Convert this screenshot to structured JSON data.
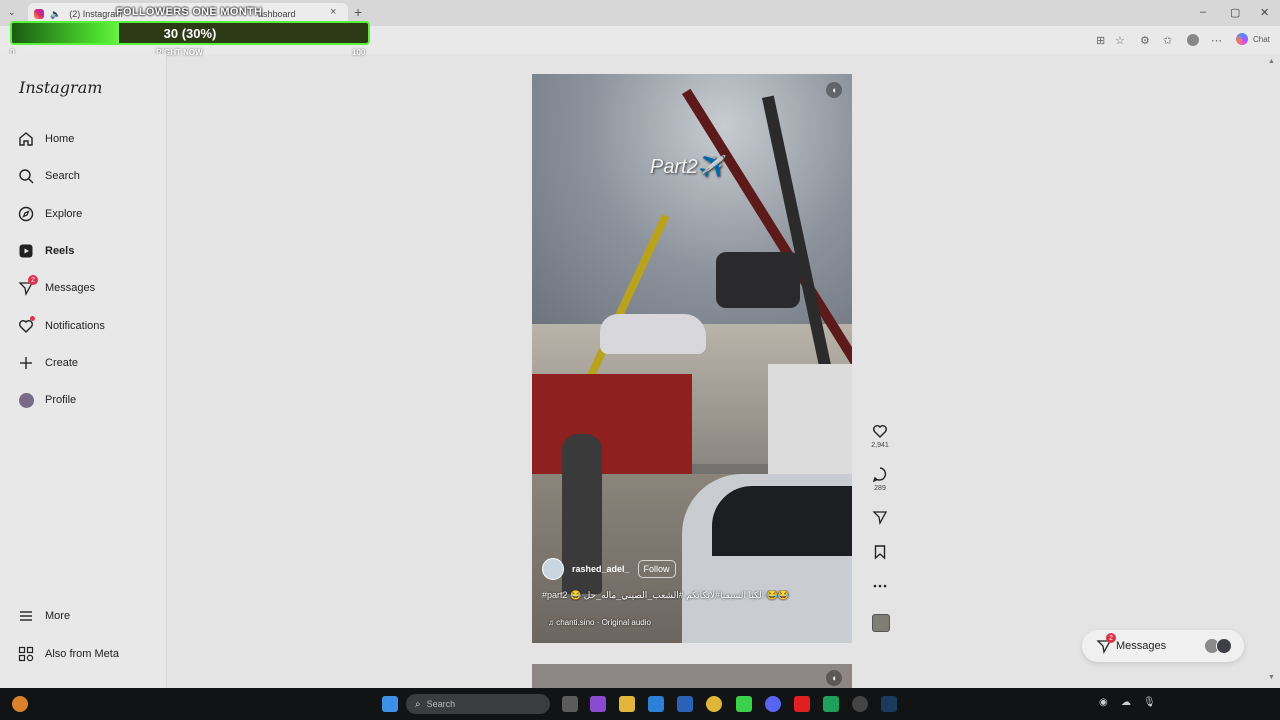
{
  "browser": {
    "tabs": [
      {
        "title": "(2) Instagram"
      },
      {
        "title": "ashboard"
      }
    ],
    "new_tab": "+",
    "close": "×",
    "window_controls": {
      "minimize": "–",
      "maximize": "▢",
      "close": "✕"
    },
    "chat_label": "Chat"
  },
  "overlay": {
    "title": "FOLLOWERS ONE MONTH",
    "value_text": "30 (30%)",
    "progress_percent": 30,
    "min_label": "0",
    "mid_label": "RIGHT NOW",
    "max_label": "100",
    "colors": {
      "fill": "#4cdc2e",
      "border": "#57f23a",
      "track": "#2c3b16"
    }
  },
  "sidebar": {
    "logo": "Instagram",
    "items": [
      {
        "label": "Home",
        "icon": "home-icon"
      },
      {
        "label": "Search",
        "icon": "search-icon"
      },
      {
        "label": "Explore",
        "icon": "compass-icon"
      },
      {
        "label": "Reels",
        "icon": "reels-icon",
        "active": true
      },
      {
        "label": "Messages",
        "icon": "messenger-icon",
        "badge": "2"
      },
      {
        "label": "Notifications",
        "icon": "heart-icon",
        "dot": true
      },
      {
        "label": "Create",
        "icon": "plus-icon"
      },
      {
        "label": "Profile",
        "icon": "avatar"
      }
    ],
    "bottom": [
      {
        "label": "More",
        "icon": "menu-icon"
      },
      {
        "label": "Also from Meta",
        "icon": "meta-apps-icon"
      }
    ]
  },
  "reel": {
    "overlay_text": "Part2✈️",
    "author": "rashed_adel_",
    "follow_label": "Follow",
    "caption": "#part2 😂 الكيا السيفيا#لايكاتكم #الشعب_الصيني_ماله_حل 😂😂",
    "audio": "♫ chanti.sino · Original audio"
  },
  "actions": {
    "likes": "2,941",
    "comments": "289"
  },
  "messages_pill": {
    "label": "Messages",
    "badge": "2"
  },
  "taskbar": {
    "search_placeholder": "Search"
  }
}
